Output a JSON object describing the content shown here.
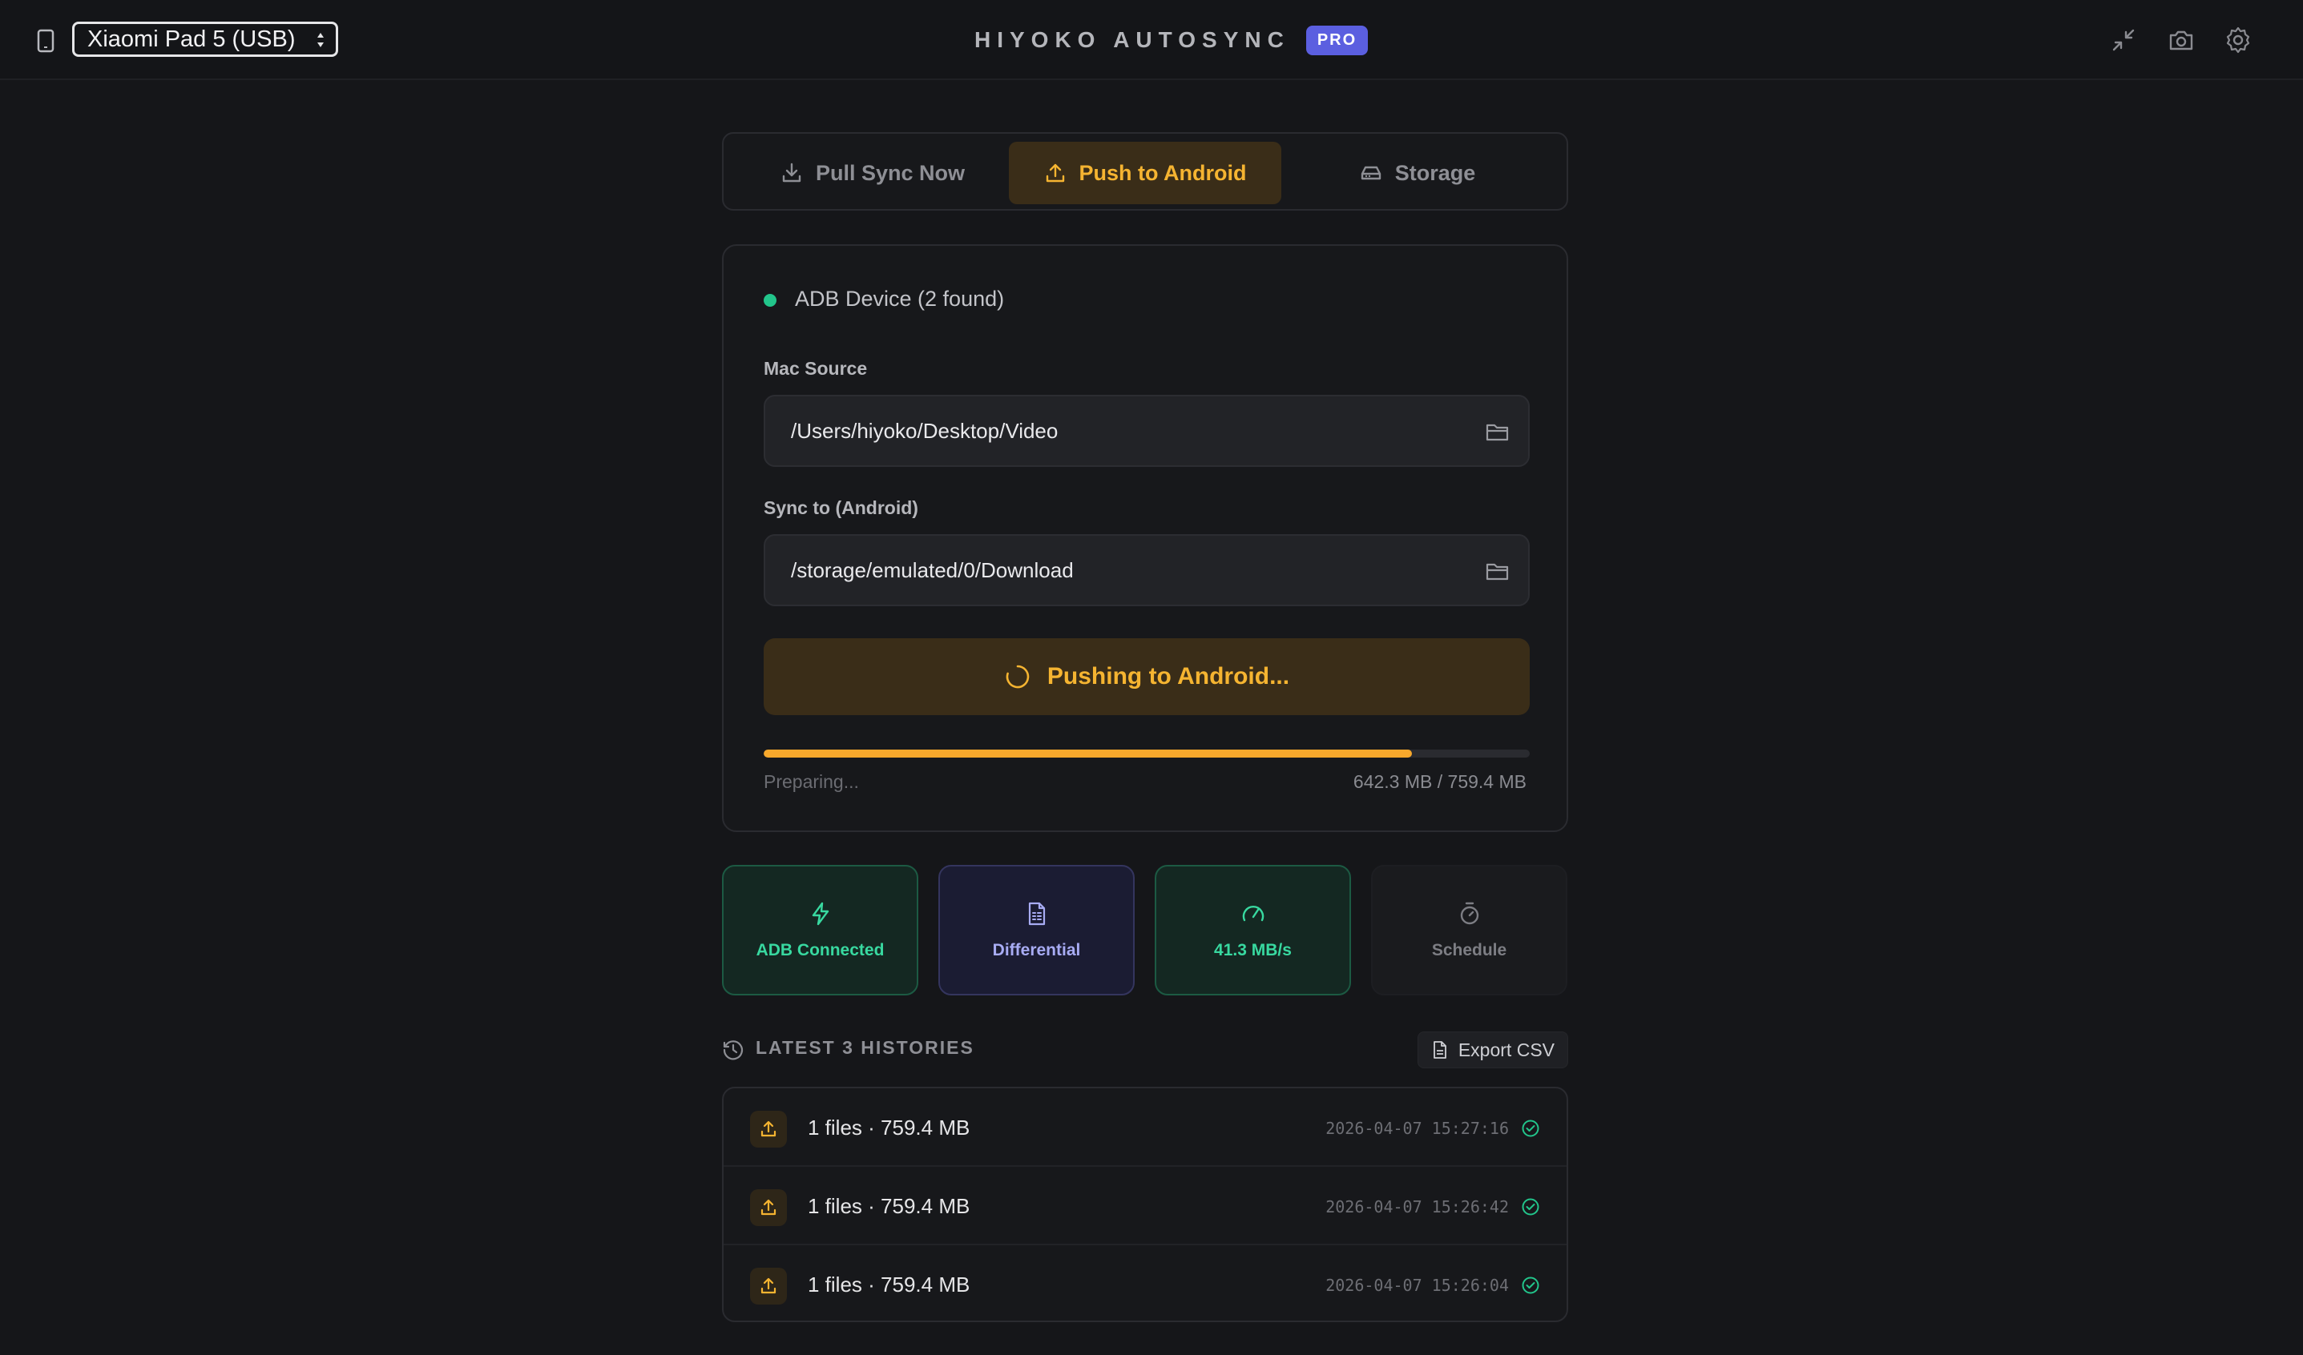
{
  "header": {
    "device_select_value": "Xiaomi Pad 5 (USB)",
    "app_name": "HIYOKO AUTOSYNC",
    "badge": "PRO",
    "icons": [
      "device-icon",
      "minimize-icon",
      "camera-icon",
      "gear-icon"
    ]
  },
  "tabs": [
    {
      "label": "Pull Sync Now",
      "icon": "download-icon",
      "active": false
    },
    {
      "label": "Push to Android",
      "icon": "upload-icon",
      "active": true
    },
    {
      "label": "Storage",
      "icon": "drive-icon",
      "active": false
    }
  ],
  "sync_card": {
    "status_text": "ADB Device (2 found)",
    "mac_source_label": "Mac Source",
    "mac_source_value": "/Users/hiyoko/Desktop/Video",
    "android_target_label": "Sync to (Android)",
    "android_target_value": "/storage/emulated/0/Download",
    "action_label": "Pushing to Android...",
    "progress_status": "Preparing...",
    "progress_text": "642.3 MB / 759.4 MB",
    "progress_fraction": 0.846
  },
  "tiles": [
    {
      "label": "ADB Connected",
      "icon": "lightning-icon"
    },
    {
      "label": "Differential",
      "icon": "document-icon"
    },
    {
      "label": "41.3 MB/s",
      "icon": "gauge-icon"
    },
    {
      "label": "Schedule",
      "icon": "stopwatch-icon"
    }
  ],
  "history": {
    "title": "LATEST 3 HISTORIES",
    "export_label": "Export CSV",
    "rows": [
      {
        "summary": "1 files · 759.4 MB",
        "timestamp": "2026-04-07 15:27:16",
        "status": "success"
      },
      {
        "summary": "1 files · 759.4 MB",
        "timestamp": "2026-04-07 15:26:42",
        "status": "success"
      },
      {
        "summary": "1 files · 759.4 MB",
        "timestamp": "2026-04-07 15:26:04",
        "status": "success"
      }
    ]
  },
  "colors": {
    "background": "#151619",
    "accent": "#f5b431",
    "success": "#22c58b",
    "brand": "#5b5fe0"
  }
}
